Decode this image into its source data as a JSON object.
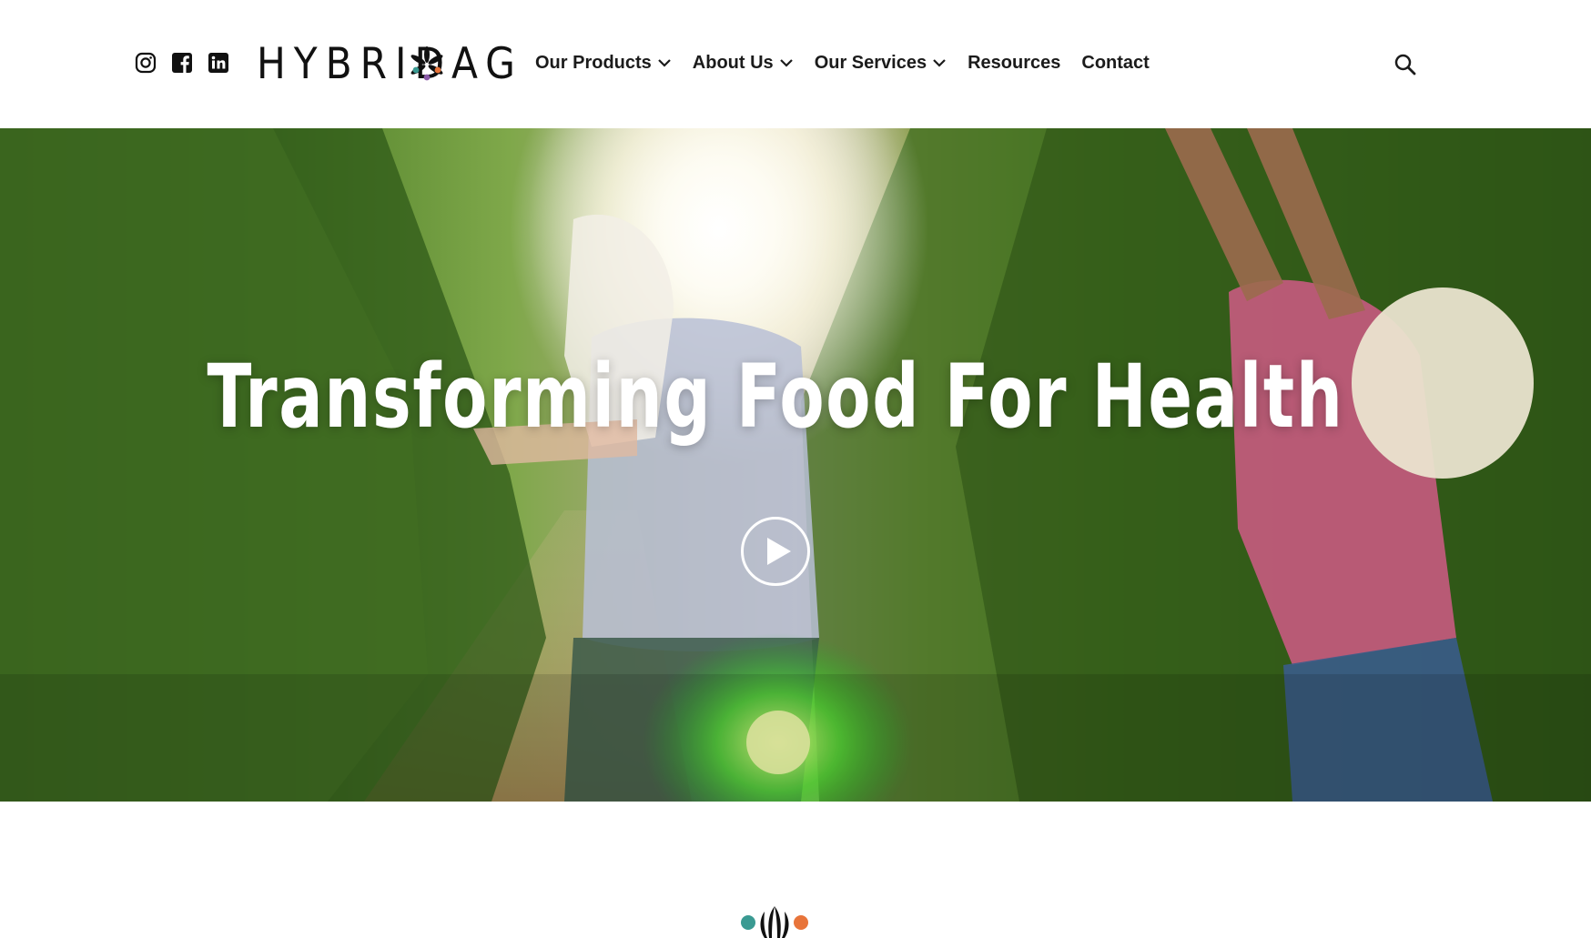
{
  "header": {
    "social": [
      {
        "icon": "instagram-icon",
        "label": "Instagram"
      },
      {
        "icon": "facebook-icon",
        "label": "Facebook"
      },
      {
        "icon": "linkedin-icon",
        "label": "LinkedIn"
      }
    ],
    "logo": {
      "left": "HYBRID",
      "right": "AG"
    },
    "nav": [
      {
        "label": "Our Products",
        "has_dropdown": true
      },
      {
        "label": "About Us",
        "has_dropdown": true
      },
      {
        "label": "Our Services",
        "has_dropdown": true
      },
      {
        "label": "Resources",
        "has_dropdown": false
      },
      {
        "label": "Contact",
        "has_dropdown": false
      }
    ],
    "search_icon": "search-icon"
  },
  "hero": {
    "title": "Transforming Food For Health",
    "play_icon": "play-icon"
  },
  "colors": {
    "logo_teal": "#3a9a92",
    "logo_orange": "#e8743a",
    "logo_purple": "#8a5aa8",
    "text_dark": "#1b1b1b"
  }
}
